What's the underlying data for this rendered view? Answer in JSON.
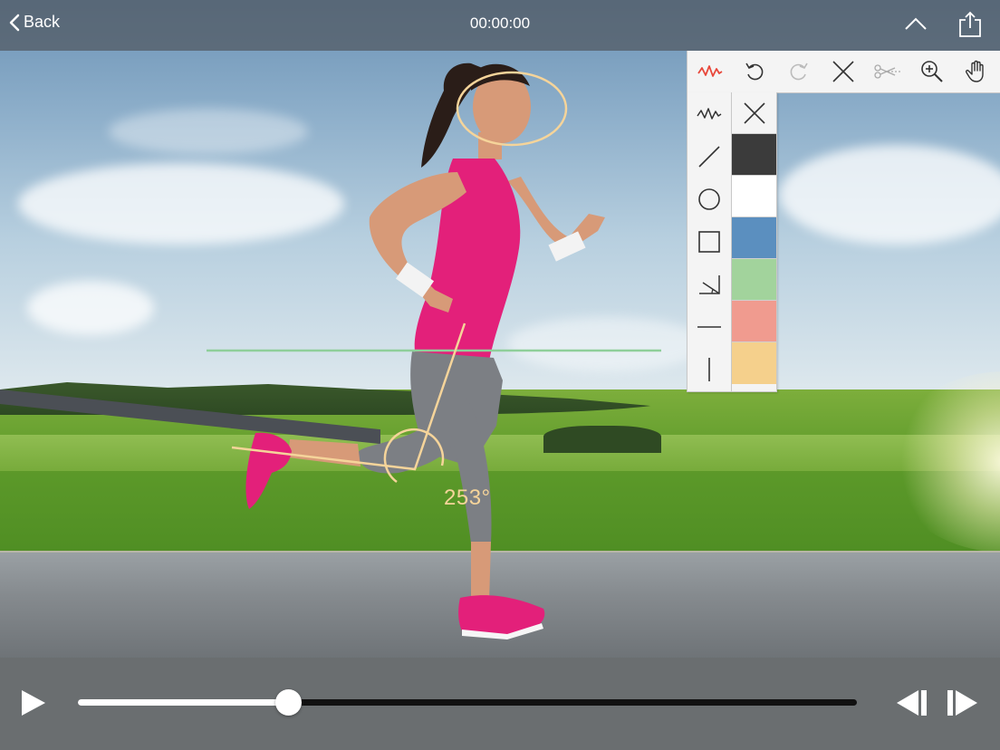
{
  "header": {
    "back_label": "Back",
    "timecode": "00:00:00"
  },
  "annotation": {
    "angle_label": "253°",
    "horizontal_line_color": "#8fcf9a",
    "drawing_color": "#f5d49a"
  },
  "toolbar": {
    "tools": [
      "freehand-icon",
      "undo-icon",
      "redo-icon",
      "clear-icon",
      "cut-icon",
      "zoom-icon",
      "pan-hand-icon"
    ],
    "active_tool": "freehand-icon",
    "active_color": "#e8473a"
  },
  "shapes": [
    "freehand",
    "line",
    "circle",
    "rectangle",
    "angle",
    "horizontal-line",
    "vertical-line"
  ],
  "colors": [
    "#3b3b3b",
    "#ffffff",
    "#5b8fbf",
    "#a2d39c",
    "#f09b8f",
    "#f5d08c"
  ],
  "player": {
    "progress": 0.27
  }
}
